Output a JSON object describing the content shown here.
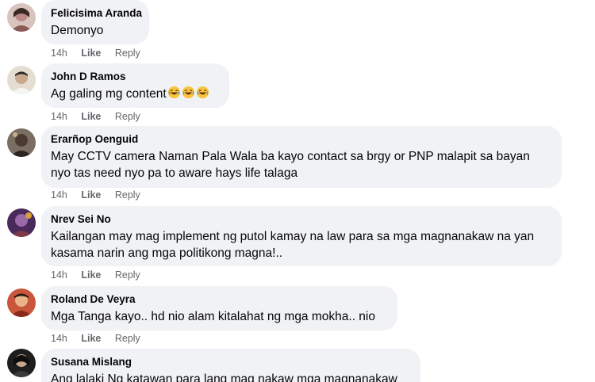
{
  "comments": [
    {
      "author": "Felicisima Aranda",
      "text": "Demonyo",
      "time": "14h",
      "like": "Like",
      "reply": "Reply",
      "avatar_color": "#b98a86"
    },
    {
      "author": "John D Ramos",
      "text": "Ag galing mg content",
      "emoji_suffix": "😂😂😂",
      "time": "14h",
      "like": "Like",
      "reply": "Reply",
      "avatar_color": "#c9b9a8"
    },
    {
      "author": "Erarñop Oenguid",
      "text_lines": [
        "May CCTV camera Naman Pala Wala ba kayo contact sa brgy or PNP malapit sa bayan",
        "nyo tas need nyo pa to aware hays life talaga"
      ],
      "time": "14h",
      "like": "Like",
      "reply": "Reply",
      "avatar_color": "#5a4a3e"
    },
    {
      "author": "Nrev Sei No",
      "text_lines": [
        "Kailangan may mag implement ng putol kamay na law para sa mga magnanakaw na yan",
        "kasama narin ang mga politikong magna!.."
      ],
      "time": "14h",
      "like": "Like",
      "reply": "Reply",
      "avatar_color": "#6a3a7a"
    },
    {
      "author": "Roland De Veyra",
      "text": "Mga Tanga kayo.. hd nio alam kitalahat ng mga mokha.. nio",
      "time": "14h",
      "like": "Like",
      "reply": "Reply",
      "avatar_color": "#b8473a"
    },
    {
      "author": "Susana Mislang",
      "text": "Ang lalaki Ng katawan para lang mag nakaw mga magnanakaw",
      "avatar_color": "#2c2c2c"
    }
  ]
}
